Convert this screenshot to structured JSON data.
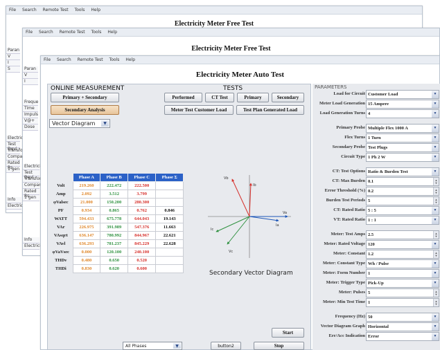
{
  "menu": [
    "File",
    "Search",
    "Remote Test",
    "Tools",
    "Help"
  ],
  "back_windows": [
    {
      "title": "Electricity Meter Free Test"
    },
    {
      "title": "Electricity Meter Free Test"
    }
  ],
  "ghost_labels": {
    "a": [
      "Paran",
      "V",
      "I",
      "S",
      "Freque",
      "Time",
      "Impuls",
      "V@+",
      "Dose"
    ],
    "b": [
      "Freque",
      "Time",
      "Impuls",
      "V@+",
      "Dose"
    ],
    "c": [
      "Electricity",
      "Test Devi",
      "Transform",
      "Comparat",
      "Rated Rs",
      "1 gen"
    ],
    "d": [
      "Info",
      "Electricity"
    ]
  },
  "main": {
    "title": "Electricity Meter Auto Test",
    "online_title": "ONLINE MEASUREMENT",
    "tests_title": "TESTS",
    "params_title": "PARAMETERS",
    "buttons": {
      "primary_secondary": "Primary + Secondary",
      "secondary_analysis": "Secondary Analysis",
      "performed": "Performed",
      "ct_test": "CT Test",
      "primary": "Primary",
      "secondary": "Secondary",
      "meter_test_customer": "Meter Test Customer Load",
      "test_plan_generated": "Test Plan Generated Load",
      "start": "Start",
      "stop": "Stop",
      "button2": "button2"
    },
    "view_select": "Vector Diagram",
    "phase_select": "All Phases",
    "table": {
      "headers": [
        "Phase A",
        "Phase B",
        "Phase C",
        "Phase Σ"
      ],
      "rows": [
        {
          "label": "Volt",
          "a": "219.260",
          "b": "222.472",
          "c": "222.500",
          "s": ""
        },
        {
          "label": "Amp",
          "a": "2.092",
          "b": "3.512",
          "c": "3.799",
          "s": ""
        },
        {
          "label": "φValsec",
          "a": "21.000",
          "b": "150.200",
          "c": "280.300",
          "s": ""
        },
        {
          "label": "PF",
          "a": "0.934",
          "b": "0.865",
          "c": "0.762",
          "s": "0.846"
        },
        {
          "label": "WATT",
          "a": "594.433",
          "b": "675.778",
          "c": "644.043",
          "s": "19.143"
        },
        {
          "label": "VAr",
          "a": "226.975",
          "b": "391.989",
          "c": "547.376",
          "s": "11.663"
        },
        {
          "label": "VAsqrt",
          "a": "636.147",
          "b": "780.992",
          "c": "844.967",
          "s": "22.621"
        },
        {
          "label": "VAvl",
          "a": "636.293",
          "b": "781.237",
          "c": "845.229",
          "s": "22.628"
        },
        {
          "label": "φVaVsec",
          "a": "0.000",
          "b": "120.100",
          "c": "240.100",
          "s": ""
        },
        {
          "label": "THDv",
          "a": "0.480",
          "b": "0.650",
          "c": "0.520",
          "s": ""
        },
        {
          "label": "THDi",
          "a": "0.830",
          "b": "0.620",
          "c": "0.600",
          "s": ""
        }
      ]
    },
    "vector_caption": "Secondary Vector Diagram",
    "vector_labels": {
      "va": "Va",
      "vb": "Vb",
      "vc": "Vc",
      "ia": "Ia",
      "ib": "Ib",
      "ic": "Ic"
    }
  },
  "params": [
    {
      "label": "Load for Circuit",
      "value": "Customer Load",
      "ctrl": "dropdown"
    },
    {
      "label": "Meter Load Generation",
      "value": "15 Ampere",
      "ctrl": "dropdown"
    },
    {
      "label": "Load Generation Turns",
      "value": "4",
      "ctrl": "dropdown"
    },
    {
      "label": "Primary Probe",
      "value": "Multiple Flex 1000 A",
      "ctrl": "dropdown"
    },
    {
      "label": "Flex Turns",
      "value": "1 Turn",
      "ctrl": "dropdown"
    },
    {
      "label": "Secondary Probe",
      "value": "Test Plugs",
      "ctrl": "dropdown"
    },
    {
      "label": "Circuit Type",
      "value": "1 Ph 2 W",
      "ctrl": "dropdown"
    },
    {
      "label": "CT: Test Options",
      "value": "Ratio & Burden Test",
      "ctrl": "dropdown"
    },
    {
      "label": "CT: Max Burden",
      "value": "0.1",
      "ctrl": "spin"
    },
    {
      "label": "Error Threshold (%)",
      "value": "0.2",
      "ctrl": "spin"
    },
    {
      "label": "Burden Test Periods",
      "value": "5",
      "ctrl": "spin"
    },
    {
      "label": "CT: Rated Ratio",
      "value": "5 : 5",
      "ctrl": "dropdown"
    },
    {
      "label": "VT: Rated Ratio",
      "value": "1 : 1",
      "ctrl": "dropdown"
    },
    {
      "label": "Meter: Test Amps",
      "value": "2.5",
      "ctrl": "spin"
    },
    {
      "label": "Meter: Rated Voltage",
      "value": "120",
      "ctrl": "dropdown"
    },
    {
      "label": "Meter: Constant",
      "value": "1.2",
      "ctrl": "spin"
    },
    {
      "label": "Meter: Constant Type",
      "value": "Wh / Pulse",
      "ctrl": "dropdown"
    },
    {
      "label": "Meter: Form Number",
      "value": "1",
      "ctrl": "dropdown"
    },
    {
      "label": "Meter: Trigger Type",
      "value": "Pick-Up",
      "ctrl": "dropdown"
    },
    {
      "label": "Meter: Pulses",
      "value": "5",
      "ctrl": "spin"
    },
    {
      "label": "Meter: Min Test Time",
      "value": "1",
      "ctrl": "spin"
    },
    {
      "label": "Frequency (Hz)",
      "value": "50",
      "ctrl": "dropdown"
    },
    {
      "label": "Vector Diagram Graph",
      "value": "Horizontal",
      "ctrl": "dropdown"
    },
    {
      "label": "Err/Acc Indication",
      "value": "Error",
      "ctrl": "dropdown"
    }
  ]
}
